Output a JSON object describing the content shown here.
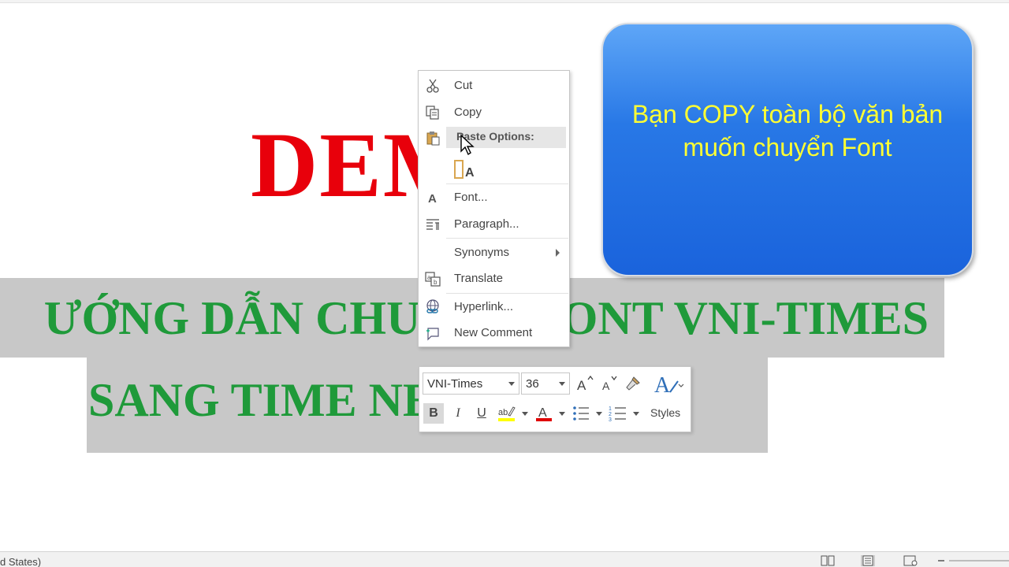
{
  "document": {
    "heading": "DEMO",
    "line1": "ƯỚNG DẪN CHUYỂN FONT VNI-TIMES",
    "line2": "SANG TIME NEW ROMAN"
  },
  "callout": {
    "text": "Bạn COPY toàn bộ văn bản muốn chuyển Font"
  },
  "context_menu": {
    "items": [
      {
        "label": "Cut",
        "icon": "scissors-icon"
      },
      {
        "label": "Copy",
        "icon": "copy-icon"
      },
      {
        "label": "Paste Options:",
        "icon": "clipboard-icon"
      },
      {
        "label": "Font...",
        "icon": "font-icon"
      },
      {
        "label": "Paragraph...",
        "icon": "paragraph-icon"
      },
      {
        "label": "Synonyms",
        "icon": ""
      },
      {
        "label": "Translate",
        "icon": "translate-icon"
      },
      {
        "label": "Hyperlink...",
        "icon": "link-icon"
      },
      {
        "label": "New Comment",
        "icon": "comment-icon"
      }
    ]
  },
  "mini_toolbar": {
    "font_name": "VNI-Times",
    "font_size": "36",
    "bold": "B",
    "italic": "I",
    "underline": "U",
    "styles_label": "Styles",
    "highlight_color": "#ffff00",
    "font_color": "#e00000"
  },
  "status_bar": {
    "language": "d States)"
  },
  "colors": {
    "heading_red": "#e8000b",
    "text_green": "#1f9a3a",
    "callout_blue": "#1a63dc",
    "callout_text_yellow": "#ffff33",
    "selection_gray": "#c8c8c8"
  }
}
